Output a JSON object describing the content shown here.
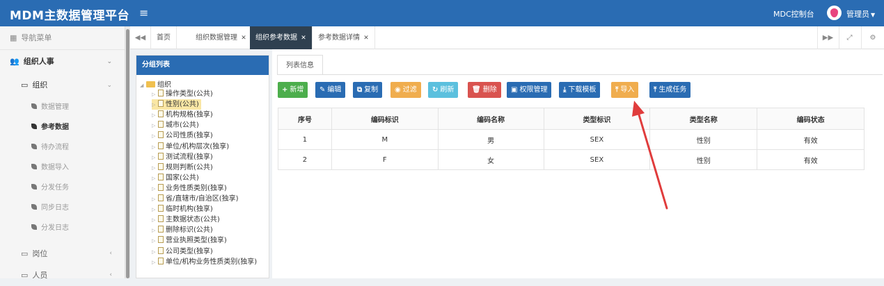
{
  "app": {
    "title": "MDM主数据管理平台",
    "console": "MDC控制台",
    "user": "管理员"
  },
  "sidebar": {
    "header": "导航菜单",
    "group": "组织人事",
    "sub": "组织",
    "items": [
      {
        "label": "数据管理"
      },
      {
        "label": "参考数据"
      },
      {
        "label": "待办流程"
      },
      {
        "label": "数据导入"
      },
      {
        "label": "分发任务"
      },
      {
        "label": "同步日志"
      },
      {
        "label": "分发日志"
      }
    ],
    "lower": [
      {
        "label": "岗位"
      },
      {
        "label": "人员"
      }
    ]
  },
  "tabs": [
    {
      "label": "首页"
    },
    {
      "label": "组织数据管理"
    },
    {
      "label": "组织参考数据"
    },
    {
      "label": "参考数据详情"
    }
  ],
  "left_panel": {
    "title": "分组列表",
    "root": "组织",
    "nodes": [
      "操作类型(公共)",
      "性别(公共)",
      "机构规格(独享)",
      "城市(公共)",
      "公司性质(独享)",
      "单位/机构层次(独享)",
      "测试流程(独享)",
      "规则判断(公共)",
      "国家(公共)",
      "业务性质类别(独享)",
      "省/直辖市/自治区(独享)",
      "临时机构(独享)",
      "主数据状态(公共)",
      "删除标识(公共)",
      "营业执照类型(独享)",
      "公司类型(独享)",
      "单位/机构业务性质类别(独享)"
    ]
  },
  "main": {
    "tab": "列表信息",
    "buttons": [
      {
        "label": "新增",
        "icon": "+",
        "color": "#4cae4c"
      },
      {
        "label": "编辑",
        "icon": "✎",
        "color": "#2a6cb3"
      },
      {
        "label": "复制",
        "icon": "⧉",
        "color": "#2a6cb3"
      },
      {
        "label": "过滤",
        "icon": "◉",
        "color": "#f0ad4e"
      },
      {
        "label": "刷新",
        "icon": "↻",
        "color": "#5bc0de"
      },
      {
        "label": "删除",
        "icon": "🗑",
        "color": "#d9534f"
      },
      {
        "label": "权限管理",
        "icon": "▣",
        "color": "#2a6cb3"
      },
      {
        "label": "下载模板",
        "icon": "⤓",
        "color": "#2a6cb3"
      },
      {
        "label": "导入",
        "icon": "⤒",
        "color": "#f0ad4e"
      },
      {
        "label": "生成任务",
        "icon": "⤒",
        "color": "#2a6cb3"
      }
    ],
    "table": {
      "headers": [
        "序号",
        "编码标识",
        "编码名称",
        "类型标识",
        "类型名称",
        "编码状态"
      ],
      "rows": [
        [
          "1",
          "M",
          "男",
          "SEX",
          "性别",
          "有效"
        ],
        [
          "2",
          "F",
          "女",
          "SEX",
          "性别",
          "有效"
        ]
      ]
    }
  }
}
